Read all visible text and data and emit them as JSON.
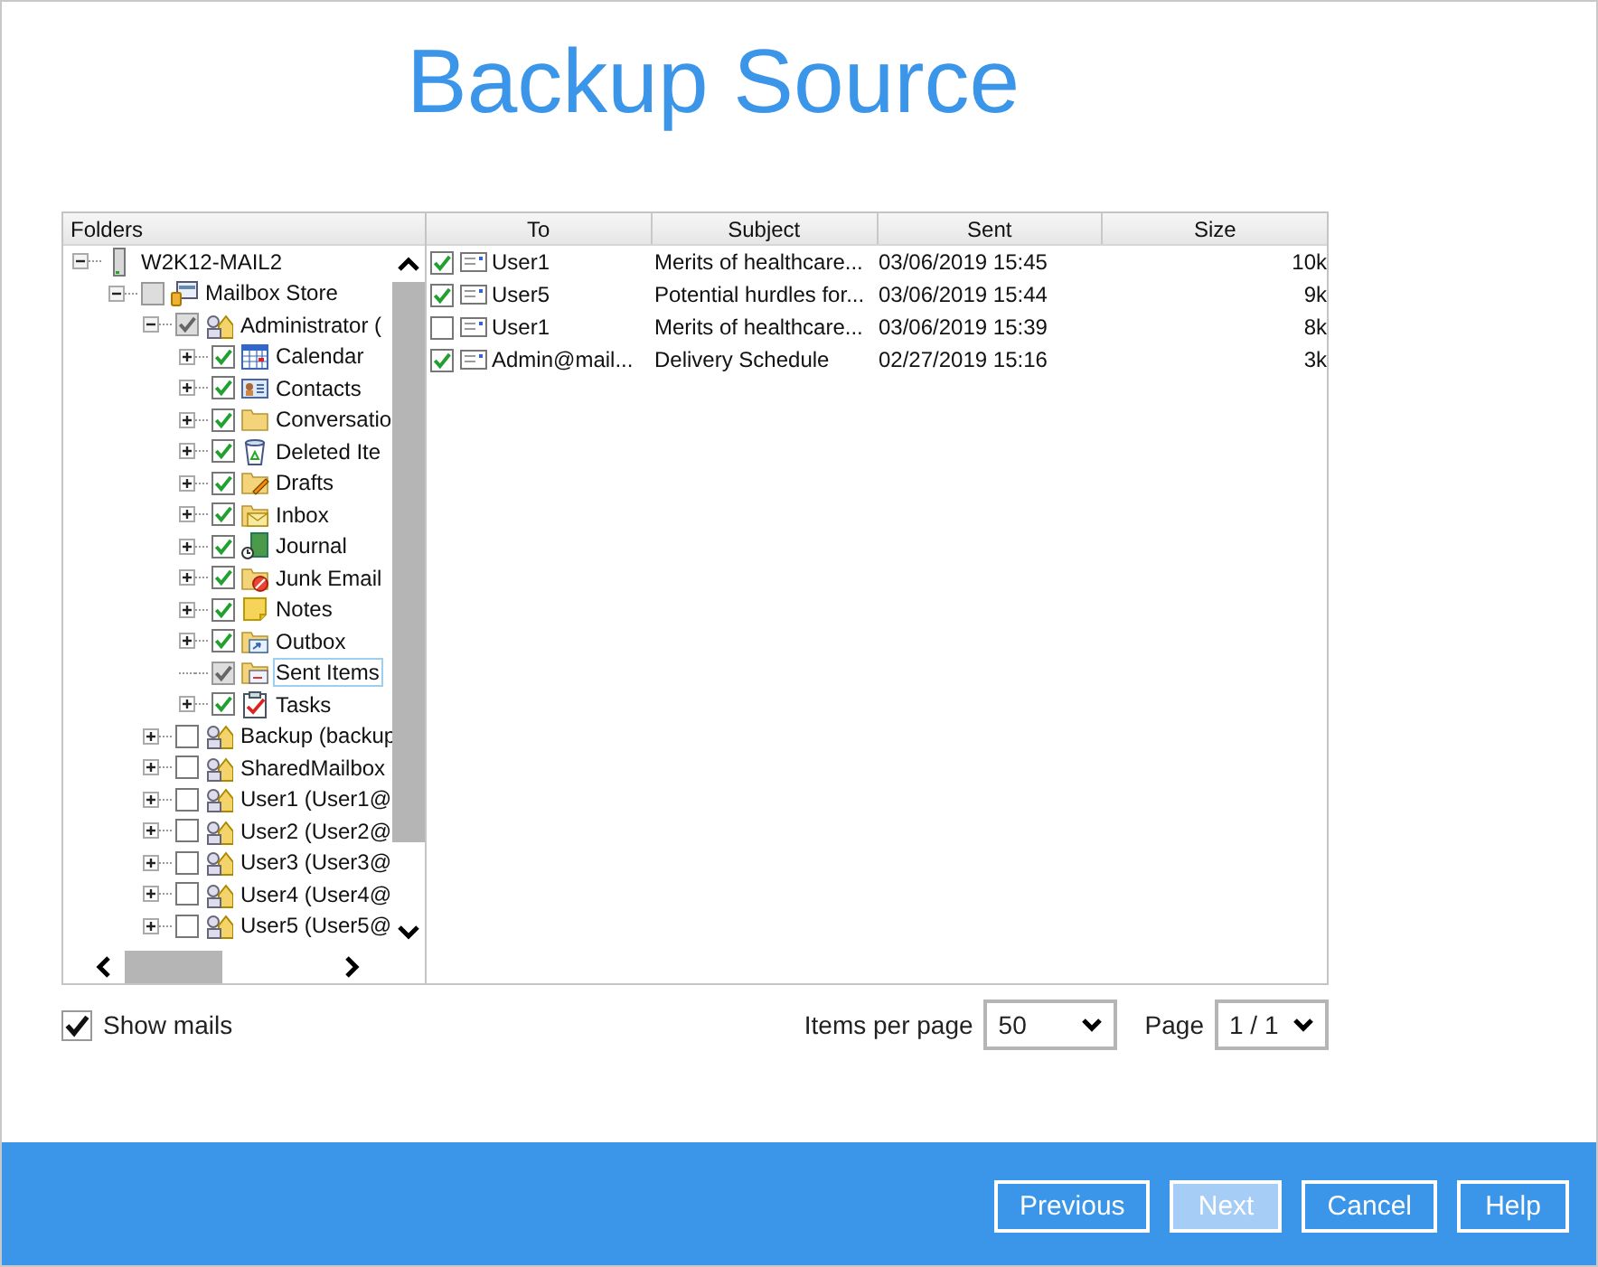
{
  "title": "Backup Source",
  "tree": {
    "header": "Folders",
    "items": [
      {
        "label": "W2K12-MAIL2",
        "kind": "server",
        "expanded": true,
        "has_children": true,
        "selected": false,
        "children": [
          {
            "label": "Mailbox Store",
            "kind": "store",
            "checked": false,
            "partial": true,
            "expanded": true,
            "has_children": true,
            "selected": false,
            "children": [
              {
                "label": "Administrator (",
                "kind": "mailbox",
                "checked": true,
                "partial": true,
                "expanded": true,
                "has_children": true,
                "selected": false,
                "children": [
                  {
                    "label": "Calendar",
                    "kind": "calendar",
                    "checked": true,
                    "partial": false,
                    "expanded": false,
                    "has_children": true,
                    "selected": false
                  },
                  {
                    "label": "Contacts",
                    "kind": "contacts",
                    "checked": true,
                    "partial": false,
                    "expanded": false,
                    "has_children": true,
                    "selected": false
                  },
                  {
                    "label": "Conversatio",
                    "kind": "folder",
                    "checked": true,
                    "partial": false,
                    "expanded": false,
                    "has_children": true,
                    "selected": false
                  },
                  {
                    "label": "Deleted Ite",
                    "kind": "deleted",
                    "checked": true,
                    "partial": false,
                    "expanded": false,
                    "has_children": true,
                    "selected": false
                  },
                  {
                    "label": "Drafts",
                    "kind": "drafts",
                    "checked": true,
                    "partial": false,
                    "expanded": false,
                    "has_children": true,
                    "selected": false
                  },
                  {
                    "label": "Inbox",
                    "kind": "inbox",
                    "checked": true,
                    "partial": false,
                    "expanded": false,
                    "has_children": true,
                    "selected": false
                  },
                  {
                    "label": "Journal",
                    "kind": "journal",
                    "checked": true,
                    "partial": false,
                    "expanded": false,
                    "has_children": true,
                    "selected": false
                  },
                  {
                    "label": "Junk Email",
                    "kind": "junk",
                    "checked": true,
                    "partial": false,
                    "expanded": false,
                    "has_children": true,
                    "selected": false
                  },
                  {
                    "label": "Notes",
                    "kind": "notes",
                    "checked": true,
                    "partial": false,
                    "expanded": false,
                    "has_children": true,
                    "selected": false
                  },
                  {
                    "label": "Outbox",
                    "kind": "outbox",
                    "checked": true,
                    "partial": false,
                    "expanded": false,
                    "has_children": true,
                    "selected": false
                  },
                  {
                    "label": "Sent Items",
                    "kind": "sent",
                    "checked": true,
                    "partial": true,
                    "has_children": false,
                    "selected": true
                  },
                  {
                    "label": "Tasks",
                    "kind": "tasks",
                    "checked": true,
                    "partial": false,
                    "expanded": false,
                    "has_children": true,
                    "selected": false
                  }
                ]
              },
              {
                "label": "Backup (backup",
                "kind": "mailbox",
                "checked": false,
                "partial": false,
                "expanded": false,
                "has_children": true,
                "selected": false
              },
              {
                "label": "SharedMailbox",
                "kind": "mailbox",
                "checked": false,
                "partial": false,
                "expanded": false,
                "has_children": true,
                "selected": false
              },
              {
                "label": "User1 (User1@",
                "kind": "mailbox",
                "checked": false,
                "partial": false,
                "expanded": false,
                "has_children": true,
                "selected": false
              },
              {
                "label": "User2 (User2@",
                "kind": "mailbox",
                "checked": false,
                "partial": false,
                "expanded": false,
                "has_children": true,
                "selected": false
              },
              {
                "label": "User3 (User3@",
                "kind": "mailbox",
                "checked": false,
                "partial": false,
                "expanded": false,
                "has_children": true,
                "selected": false
              },
              {
                "label": "User4 (User4@",
                "kind": "mailbox",
                "checked": false,
                "partial": false,
                "expanded": false,
                "has_children": true,
                "selected": false
              },
              {
                "label": "User5 (User5@",
                "kind": "mailbox",
                "checked": false,
                "partial": false,
                "expanded": false,
                "has_children": true,
                "selected": false
              }
            ]
          }
        ]
      }
    ]
  },
  "mail_table": {
    "columns": [
      "To",
      "Subject",
      "Sent",
      "Size"
    ],
    "rows": [
      {
        "checked": true,
        "to": "User1",
        "subject": "Merits of healthcare...",
        "sent": "03/06/2019 15:45",
        "size": "10k"
      },
      {
        "checked": true,
        "to": "User5",
        "subject": "Potential hurdles for...",
        "sent": "03/06/2019 15:44",
        "size": "9k"
      },
      {
        "checked": false,
        "to": "User1",
        "subject": "Merits of healthcare...",
        "sent": "03/06/2019 15:39",
        "size": "8k"
      },
      {
        "checked": true,
        "to": "Admin@mail...",
        "subject": "Delivery Schedule",
        "sent": "02/27/2019 15:16",
        "size": "3k"
      }
    ]
  },
  "show_mails": {
    "label": "Show mails",
    "checked": true
  },
  "items_per_page": {
    "label": "Items per page",
    "value": "50"
  },
  "page": {
    "label": "Page",
    "value": "1 / 1"
  },
  "buttons": [
    {
      "label": "Previous",
      "disabled": false
    },
    {
      "label": "Next",
      "disabled": true
    },
    {
      "label": "Cancel",
      "disabled": false
    },
    {
      "label": "Help",
      "disabled": false
    }
  ]
}
